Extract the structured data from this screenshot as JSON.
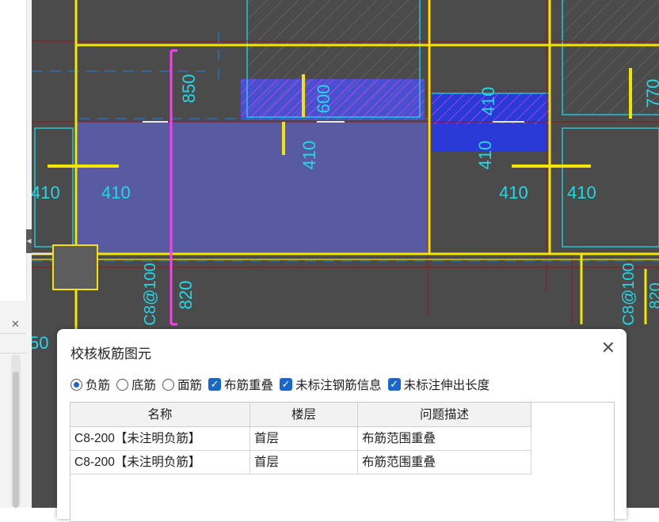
{
  "canvas": {
    "dimension_labels": {
      "d850": "850",
      "d600": "600",
      "d410_top": "410",
      "d410_center": "410",
      "d410_right": "410",
      "d770": "770",
      "d410_left_outer": "410",
      "d410_left_inner": "410",
      "d410_right_inner": "410",
      "d410_right_outer": "410",
      "d820": "820",
      "rebar_left": "C8@100",
      "rebar_right": "C8@100",
      "d820_partial": "820",
      "d50": "50"
    }
  },
  "dialog": {
    "title": "校核板筋图元",
    "close_glyph": "✕",
    "options": {
      "neg_rebar": "负筋",
      "bottom_rebar": "底筋",
      "top_rebar": "面筋",
      "overlap": "布筋重叠",
      "missing_info": "未标注钢筋信息",
      "missing_length": "未标注伸出长度"
    },
    "option_states": {
      "neg_rebar": true,
      "bottom_rebar": false,
      "top_rebar": false,
      "overlap": true,
      "missing_info": true,
      "missing_length": true
    },
    "table": {
      "headers": [
        "名称",
        "楼层",
        "问题描述"
      ],
      "rows": [
        [
          "C8-200【未注明负筋】",
          "首层",
          "布筋范围重叠"
        ],
        [
          "C8-200【未注明负筋】",
          "首层",
          "布筋范围重叠"
        ]
      ]
    }
  },
  "colors": {
    "accent": "#1a67c8",
    "canvas_bg": "#4b4b4b",
    "beam_yellow": "#f2e600",
    "rebar_magenta": "#ff3df0",
    "dim_cyan": "#22d8e8",
    "slab_blue": "#5a5fb8"
  }
}
